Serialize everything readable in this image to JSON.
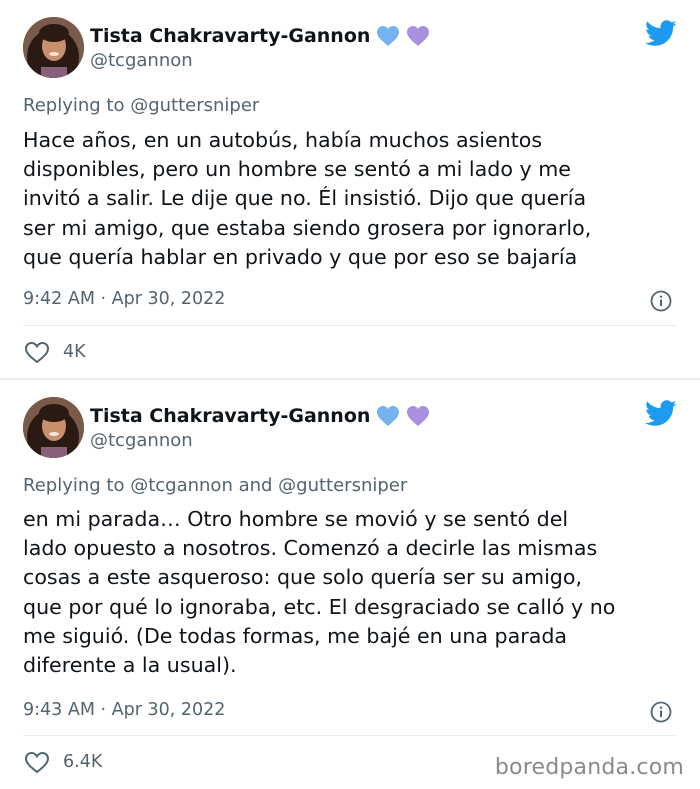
{
  "tweets": [
    {
      "author": {
        "display_name": "Tista Chakravarty-Gannon",
        "handle": "@tcgannon",
        "badges": [
          "blue-heart-icon",
          "purple-heart-icon"
        ]
      },
      "replying_prefix": "Replying to ",
      "replying_to": "@guttersniper",
      "text": "Hace años, en un autobús, había muchos asientos\ndisponibles, pero un hombre se sentó a mi lado y me\ninvitó a salir. Le dije que no. Él insistió. Dijo que quería\nser mi amigo, que estaba siendo grosera por ignorarlo,\nque quería hablar en privado y que por eso se bajaría",
      "timestamp": "9:42 AM · Apr 30, 2022",
      "likes": "4K"
    },
    {
      "author": {
        "display_name": "Tista Chakravarty-Gannon",
        "handle": "@tcgannon",
        "badges": [
          "blue-heart-icon",
          "purple-heart-icon"
        ]
      },
      "replying_prefix": "Replying to ",
      "replying_to": "@tcgannon and @guttersniper",
      "text": "en mi parada… Otro hombre se movió y se sentó del\nlado opuesto a nosotros. Comenzó a decirle las mismas\ncosas a este asqueroso: que solo quería ser su amigo,\nque por qué lo ignoraba, etc. El desgraciado se calló y no\nme siguió. (De todas formas, me bajé en una parada\ndiferente a la usual).",
      "timestamp": "9:43 AM · Apr 30, 2022",
      "likes": "6.4K"
    }
  ],
  "watermark": "boredpanda.com",
  "colors": {
    "twitter_blue": "#1d9bf0",
    "blue_heart": "#74b3f0",
    "purple_heart": "#a98fe0",
    "secondary_text": "#536471",
    "primary_text": "#0f1419",
    "separator": "#e6ecf0"
  }
}
